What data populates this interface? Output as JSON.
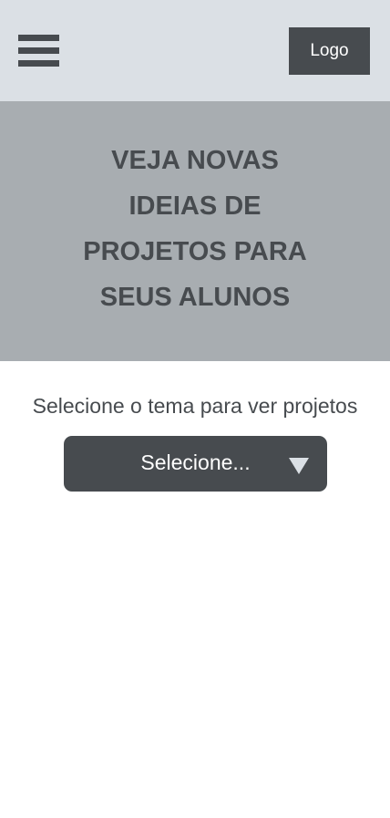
{
  "header": {
    "logo_label": "Logo",
    "menu_icon": "hamburger-menu-icon"
  },
  "hero": {
    "title_lines": [
      "VEJA NOVAS",
      "IDEIAS DE",
      "PROJETOS PARA",
      "SEUS ALUNOS"
    ]
  },
  "theme_select": {
    "prompt": "Selecione o tema para ver projetos",
    "selected_value": "Selecione...",
    "icon": "chevron-down-icon"
  },
  "colors": {
    "header_bg": "#dbe0e5",
    "hero_bg": "#a8adb1",
    "dark": "#474b4f",
    "page_bg": "#ffffff"
  }
}
